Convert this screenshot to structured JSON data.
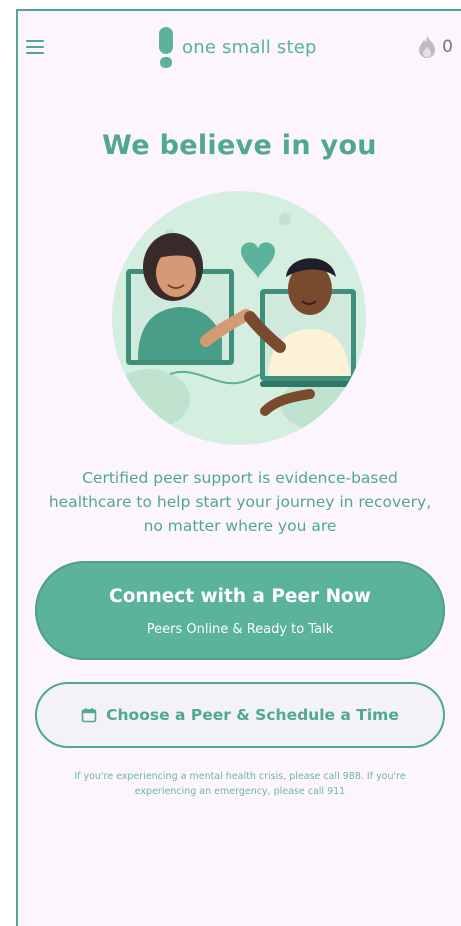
{
  "header": {
    "brand": "one small step",
    "streak_count": "0"
  },
  "main": {
    "headline": "We believe in you",
    "description": "Certified peer support is evidence-based healthcare to help start your journey in recovery, no matter where you are",
    "primary_button": {
      "title": "Connect with a Peer Now",
      "subtitle": "Peers Online & Ready to Talk"
    },
    "secondary_button": {
      "label": "Choose a Peer & Schedule a Time"
    },
    "crisis_notice": "If you're experiencing a mental health crisis, please call 988. If you're experiencing an emergency, please call 911"
  },
  "colors": {
    "brand_green": "#4fa88f",
    "button_green": "#5ab39a",
    "background": "#fcf5fd"
  },
  "icons": [
    "menu-icon",
    "footprint-logo-icon",
    "flame-icon",
    "calendar-icon"
  ]
}
